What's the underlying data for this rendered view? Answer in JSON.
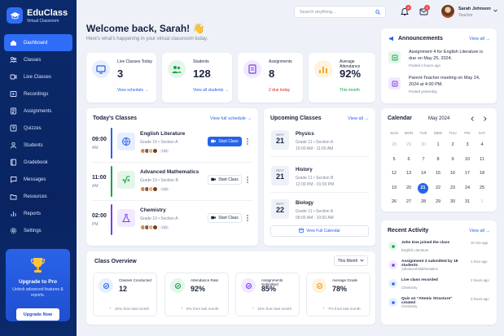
{
  "app": {
    "name": "EduClass",
    "subtitle": "Virtual Classroom"
  },
  "sidebar": {
    "items": [
      {
        "label": "Dashboard",
        "icon": "home-icon"
      },
      {
        "label": "Classes",
        "icon": "classes-icon"
      },
      {
        "label": "Live Classes",
        "icon": "live-icon"
      },
      {
        "label": "Recordings",
        "icon": "recordings-icon"
      },
      {
        "label": "Assignments",
        "icon": "assignments-icon"
      },
      {
        "label": "Quizzes",
        "icon": "quizzes-icon"
      },
      {
        "label": "Students",
        "icon": "students-icon"
      },
      {
        "label": "Gradebook",
        "icon": "gradebook-icon"
      },
      {
        "label": "Messages",
        "icon": "messages-icon"
      },
      {
        "label": "Resources",
        "icon": "resources-icon"
      },
      {
        "label": "Reports",
        "icon": "reports-icon"
      },
      {
        "label": "Settings",
        "icon": "settings-icon"
      }
    ],
    "promo": {
      "title": "Upgrade to Pro",
      "text": "Unlock advanced features & reports.",
      "button": "Upgrade Now"
    }
  },
  "topbar": {
    "search_placeholder": "Search anything...",
    "notif_count": "3",
    "msg_count": "2",
    "user_name": "Sarah Johnson",
    "user_role": "Teacher"
  },
  "header": {
    "title": "Welcome back, Sarah! 👋",
    "subtitle": "Here's what's happening in your virtual classroom today."
  },
  "stats": [
    {
      "label": "Live Classes Today",
      "value": "3",
      "foot": "View schedule →",
      "color": "#2563eb"
    },
    {
      "label": "Students",
      "value": "128",
      "foot": "View all students →",
      "color": "#2563eb"
    },
    {
      "label": "Assignments",
      "value": "8",
      "foot": "2 due today",
      "color": "#dc2626"
    },
    {
      "label": "Average Attendance",
      "value": "92%",
      "foot": "This month",
      "color": "#16a34a"
    }
  ],
  "today": {
    "title": "Today's Classes",
    "link": "View full schedule →",
    "start_label": "Start Class",
    "classes": [
      {
        "time": "09:00",
        "ampm": "AM",
        "name": "English Literature",
        "meta": "Grade 10 • Section A",
        "more": "+24",
        "live": true
      },
      {
        "time": "11:00",
        "ampm": "AM",
        "name": "Advanced Mathematics",
        "meta": "Grade 10 • Section B",
        "more": "+18",
        "live": false
      },
      {
        "time": "02:00",
        "ampm": "PM",
        "name": "Chemistry",
        "meta": "Grade 10 • Section A",
        "more": "+22",
        "live": false
      }
    ]
  },
  "upcoming": {
    "title": "Upcoming Classes",
    "link": "View all →",
    "footer": "View Full Calendar",
    "items": [
      {
        "month": "MAY",
        "day": "21",
        "name": "Physics",
        "meta": "Grade 11 • Section A",
        "time": "10:00 AM - 11:00 AM"
      },
      {
        "month": "MAY",
        "day": "21",
        "name": "History",
        "meta": "Grade 11 • Section B",
        "time": "12:00 PM - 01:00 PM"
      },
      {
        "month": "MAY",
        "day": "22",
        "name": "Biology",
        "meta": "Grade 11 • Section A",
        "time": "09:00 AM - 10:00 AM"
      }
    ]
  },
  "announcements": {
    "title": "Announcements",
    "link": "View all →",
    "items": [
      {
        "text": "Assignment 4 for English Literature is due on May 25, 2024.",
        "time": "Posted 2 hours ago"
      },
      {
        "text": "Parent-Teacher meeting on May 24, 2024 at 4:00 PM.",
        "time": "Posted yesterday"
      }
    ]
  },
  "calendar": {
    "title": "Calendar",
    "month": "May 2024",
    "days": [
      "SUN",
      "MON",
      "TUE",
      "WED",
      "THU",
      "FRI",
      "SAT"
    ],
    "weeks": [
      [
        "28",
        "29",
        "30",
        "1",
        "2",
        "3",
        "4"
      ],
      [
        "5",
        "6",
        "7",
        "8",
        "9",
        "10",
        "11"
      ],
      [
        "12",
        "13",
        "14",
        "15",
        "16",
        "17",
        "18"
      ],
      [
        "19",
        "20",
        "21",
        "22",
        "23",
        "24",
        "25"
      ],
      [
        "26",
        "27",
        "28",
        "29",
        "30",
        "31",
        "1"
      ]
    ],
    "selected": "21"
  },
  "activity": {
    "title": "Recent Activity",
    "link": "View all →",
    "items": [
      {
        "text": "John Doe joined the class",
        "sub": "English Literature",
        "time": "10 min ago",
        "color": "#16a34a"
      },
      {
        "text": "Assignment 3 submitted by 18 students",
        "sub": "Advanced Mathematics",
        "time": "1 hour ago",
        "color": "#7c3aed"
      },
      {
        "text": "Live class recorded",
        "sub": "Chemistry",
        "time": "2 hours ago",
        "color": "#2563eb"
      },
      {
        "text": "Quiz on \"Atomic Structure\" created",
        "sub": "Chemistry",
        "time": "3 hours ago",
        "color": "#2563eb"
      }
    ]
  },
  "overview": {
    "title": "Class Overview",
    "filter": "This Month",
    "items": [
      {
        "label": "Classes Conducted",
        "value": "12",
        "delta": "20% from last month"
      },
      {
        "label": "Attendance Rate",
        "value": "92%",
        "delta": "5% from last month"
      },
      {
        "label": "Assignments Submitted",
        "value": "85%",
        "delta": "10% from last month"
      },
      {
        "label": "Average Grade",
        "value": "78%",
        "delta": "7% from last month"
      }
    ]
  }
}
